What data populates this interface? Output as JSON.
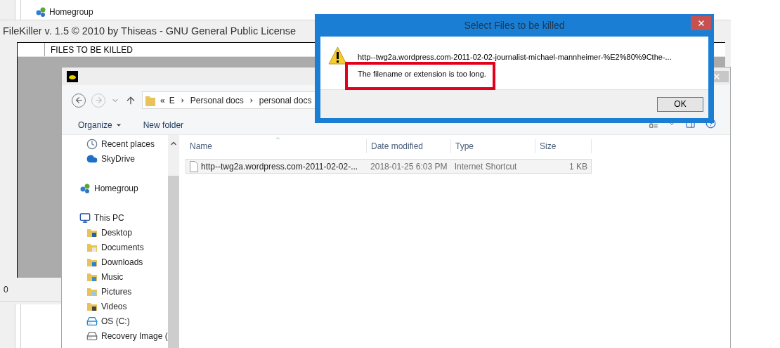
{
  "background_window": {
    "sidebar": {
      "items": [
        {
          "label": "Homegroup"
        }
      ]
    }
  },
  "filekiller": {
    "title": "FileKiller v. 1.5 © 2010 by Thiseas - GNU General Public License",
    "table": {
      "columns": [
        "FILES TO BE KILLED"
      ]
    },
    "status": "0"
  },
  "file_dialog": {
    "address": {
      "crumbs": [
        "«",
        "E",
        "Personal docs",
        "personal docs"
      ]
    },
    "toolbar": [
      {
        "label": "Organize",
        "dropdown": true
      },
      {
        "label": "New folder",
        "dropdown": false
      }
    ],
    "nav": [
      {
        "children": [
          {
            "label": "Recent places",
            "kind": "recent"
          },
          {
            "label": "SkyDrive",
            "kind": "cloud"
          }
        ]
      },
      {
        "label": "Homegroup",
        "kind": "homegroup"
      },
      {
        "label": "This PC",
        "kind": "pc",
        "children": [
          {
            "label": "Desktop",
            "kind": "desktop"
          },
          {
            "label": "Documents",
            "kind": "documents"
          },
          {
            "label": "Downloads",
            "kind": "downloads"
          },
          {
            "label": "Music",
            "kind": "music"
          },
          {
            "label": "Pictures",
            "kind": "pictures"
          },
          {
            "label": "Videos",
            "kind": "videos"
          },
          {
            "label": "OS (C:)",
            "kind": "system-drive"
          },
          {
            "label": "Recovery Image (",
            "kind": "drive"
          }
        ]
      }
    ],
    "columns": [
      "Name",
      "Date modified",
      "Type",
      "Size"
    ],
    "rows": [
      {
        "cells": [
          "http--twg2a.wordpress.com-2011-02-02-...",
          "2018-01-25 6:03 PM",
          "Internet Shortcut",
          "1 KB"
        ],
        "selected": true
      }
    ]
  },
  "message_box": {
    "title": "Select Files to be killed",
    "lines": [
      {
        "text": "http--twg2a.wordpress.com-2011-02-02-journalist-michael-mannheimer-%E2%80%9Cthe-...",
        "highlighted": false
      },
      {
        "text": "The filename or extension is too long.",
        "highlighted": true
      }
    ],
    "buttons": [
      "OK"
    ]
  }
}
